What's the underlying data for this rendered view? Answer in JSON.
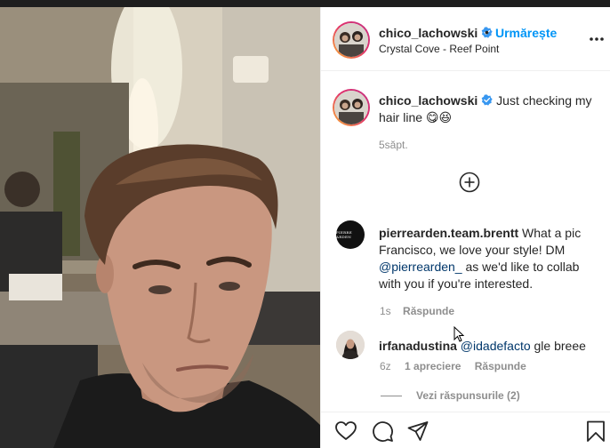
{
  "header": {
    "username": "chico_lachowski",
    "separator": "•",
    "follow_label": "Urmărește",
    "location": "Crystal Cove - Reef Point"
  },
  "caption": {
    "username": "chico_lachowski",
    "text": "Just checking my hair line 😋😆",
    "time": "5săpt."
  },
  "comments": [
    {
      "username": "pierrearden.team.brentt",
      "avatar_text": "PIERRE ARDEN",
      "text_before": " What a pic Francisco, we love your style! DM ",
      "mention": "@pierrearden_",
      "text_after": " as we'd like to collab with you if you're interested.",
      "time": "1s",
      "reply_label": "Răspunde"
    },
    {
      "username": "irfanadustina",
      "mention": "@idadefacto",
      "text_after": " gle breee",
      "time": "6z",
      "likes_label": "1 apreciere",
      "reply_label": "Răspunde"
    }
  ],
  "view_replies_label": "Vezi răspunsurile (2)",
  "colors": {
    "accent": "#0095f6",
    "mention": "#00376b",
    "secondary_text": "#8e8e8e",
    "verified": "#3897f0"
  },
  "icons": {
    "more": "more-horizontal-icon",
    "add_comment": "plus-circle-icon",
    "like": "heart-icon",
    "comment": "comment-icon",
    "share": "share-icon",
    "save": "bookmark-icon"
  }
}
